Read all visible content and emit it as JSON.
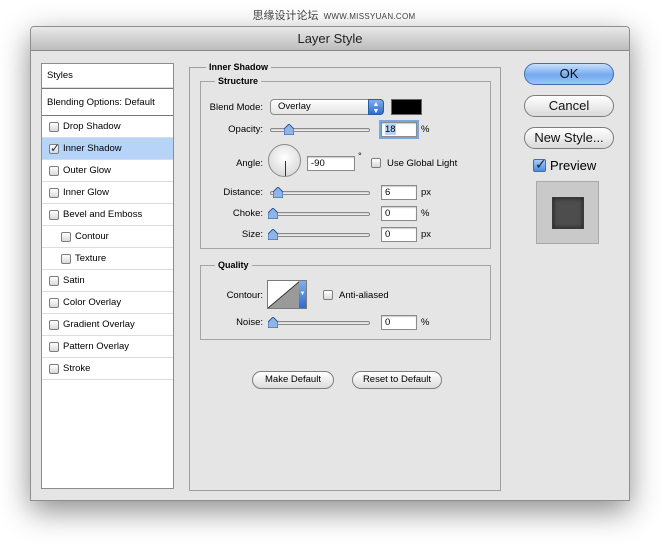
{
  "watermark": {
    "text": "思缘设计论坛",
    "site": "WWW.MISSYUAN.COM"
  },
  "window": {
    "title": "Layer Style"
  },
  "style_list": {
    "header": "Styles",
    "blending": "Blending Options: Default",
    "items": [
      {
        "label": "Drop Shadow",
        "checked": false,
        "selected": false,
        "sub": false
      },
      {
        "label": "Inner Shadow",
        "checked": true,
        "selected": true,
        "sub": false
      },
      {
        "label": "Outer Glow",
        "checked": false,
        "selected": false,
        "sub": false
      },
      {
        "label": "Inner Glow",
        "checked": false,
        "selected": false,
        "sub": false
      },
      {
        "label": "Bevel and Emboss",
        "checked": false,
        "selected": false,
        "sub": false
      },
      {
        "label": "Contour",
        "checked": false,
        "selected": false,
        "sub": true
      },
      {
        "label": "Texture",
        "checked": false,
        "selected": false,
        "sub": true
      },
      {
        "label": "Satin",
        "checked": false,
        "selected": false,
        "sub": false
      },
      {
        "label": "Color Overlay",
        "checked": false,
        "selected": false,
        "sub": false
      },
      {
        "label": "Gradient Overlay",
        "checked": false,
        "selected": false,
        "sub": false
      },
      {
        "label": "Pattern Overlay",
        "checked": false,
        "selected": false,
        "sub": false
      },
      {
        "label": "Stroke",
        "checked": false,
        "selected": false,
        "sub": false
      }
    ]
  },
  "panel": {
    "title": "Inner Shadow",
    "structure": {
      "title": "Structure",
      "blend_mode_label": "Blend Mode:",
      "blend_mode_value": "Overlay",
      "shadow_color": "#000000",
      "opacity_label": "Opacity:",
      "opacity_value": "18",
      "opacity_unit": "%",
      "angle_label": "Angle:",
      "angle_value": "-90",
      "angle_unit": "°",
      "global_light_label": "Use Global Light",
      "global_light_checked": false,
      "distance_label": "Distance:",
      "distance_value": "6",
      "distance_unit": "px",
      "choke_label": "Choke:",
      "choke_value": "0",
      "choke_unit": "%",
      "size_label": "Size:",
      "size_value": "0",
      "size_unit": "px"
    },
    "quality": {
      "title": "Quality",
      "contour_label": "Contour:",
      "antialiased_label": "Anti-aliased",
      "antialiased_checked": false,
      "noise_label": "Noise:",
      "noise_value": "0",
      "noise_unit": "%"
    },
    "make_default": "Make Default",
    "reset_default": "Reset to Default"
  },
  "actions": {
    "ok": "OK",
    "cancel": "Cancel",
    "new_style": "New Style...",
    "preview_label": "Preview",
    "preview_checked": true
  }
}
